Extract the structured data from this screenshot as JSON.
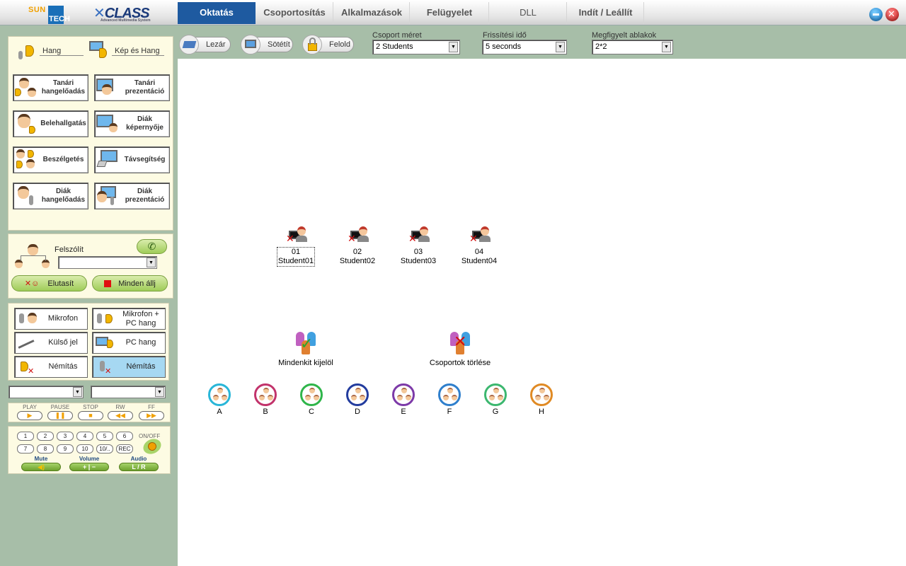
{
  "brand": {
    "sun": "SUN",
    "tech": "TECH",
    "product": "CLASS",
    "tagline": "Advanced Multimedia System"
  },
  "tabs": [
    {
      "label": "Oktatás",
      "active": true
    },
    {
      "label": "Csoportosítás"
    },
    {
      "label": "Alkalmazások"
    },
    {
      "label": "Felügyelet"
    },
    {
      "label": "DLL"
    },
    {
      "label": "Indít / Leállít"
    }
  ],
  "window_controls": {
    "minimize": "minimize-icon",
    "close": "close-icon"
  },
  "mode_panel": {
    "audio_label": "Hang",
    "video_audio_label": "Kép és Hang",
    "buttons": [
      {
        "label": "Tanári hangelőadás",
        "icon": "teacher-audio-icon"
      },
      {
        "label": "Tanári prezentáció",
        "icon": "teacher-presentation-icon"
      },
      {
        "label": "Belehallgatás",
        "icon": "monitor-audio-icon"
      },
      {
        "label": "Diák képernyője",
        "icon": "student-screen-icon"
      },
      {
        "label": "Beszélgetés",
        "icon": "conversation-icon"
      },
      {
        "label": "Távsegítség",
        "icon": "remote-help-icon"
      },
      {
        "label": "Diák hangelőadás",
        "icon": "student-audio-icon"
      },
      {
        "label": "Diák prezentáció",
        "icon": "student-presentation-icon"
      }
    ]
  },
  "call_panel": {
    "call_label": "Felszólít",
    "call_value": "",
    "reject_label": "Elutasít",
    "stop_all_label": "Minden állj"
  },
  "source_panel": {
    "buttons": [
      {
        "label": "Mikrofon",
        "selected": false
      },
      {
        "label": "Mikrofon + PC hang",
        "selected": false
      },
      {
        "label": "Külső jel",
        "selected": false
      },
      {
        "label": "PC hang",
        "selected": false
      },
      {
        "label": "Némítás",
        "selected": false
      },
      {
        "label": "Némítás",
        "selected": true
      }
    ]
  },
  "player": {
    "combo1": "",
    "combo2": "",
    "controls": [
      {
        "label": "PLAY",
        "glyph": "▶"
      },
      {
        "label": "PAUSE",
        "glyph": "❚❚"
      },
      {
        "label": "STOP",
        "glyph": "■"
      },
      {
        "label": "RW",
        "glyph": "◀◀"
      },
      {
        "label": "FF",
        "glyph": "▶▶"
      }
    ]
  },
  "keypad": {
    "row1": [
      "1",
      "2",
      "3",
      "4",
      "5",
      "6"
    ],
    "row2": [
      "7",
      "8",
      "9",
      "10",
      "10/..",
      "REC"
    ],
    "onoff": "ON/OFF",
    "mute_label": "Mute",
    "volume_label": "Volume",
    "volume_glyph": "+ | −",
    "audio_label": "Audio",
    "audio_glyph": "L / R"
  },
  "toolbar": {
    "lock": "Lezár",
    "blackout": "Sötétít",
    "unlock": "Felold",
    "group_size_label": "Csoport méret",
    "group_size_value": "2 Students",
    "refresh_label": "Frissítési idő",
    "refresh_value": "5 seconds",
    "windows_label": "Megfigyelt ablakok",
    "windows_value": "2*2"
  },
  "students": [
    {
      "num": "01",
      "name": "Student01",
      "selected": true
    },
    {
      "num": "02",
      "name": "Student02"
    },
    {
      "num": "03",
      "name": "Student03"
    },
    {
      "num": "04",
      "name": "Student04"
    }
  ],
  "actions": {
    "select_all": "Mindenkit kijelöl",
    "delete_groups": "Csoportok törlése"
  },
  "groups": [
    {
      "label": "A",
      "color": "#29b6d8"
    },
    {
      "label": "B",
      "color": "#c2336b"
    },
    {
      "label": "C",
      "color": "#2fb54a"
    },
    {
      "label": "D",
      "color": "#233c9e"
    },
    {
      "label": "E",
      "color": "#7d3aa8"
    },
    {
      "label": "F",
      "color": "#2f7fcc"
    },
    {
      "label": "G",
      "color": "#3cb76f"
    },
    {
      "label": "H",
      "color": "#e08a24"
    }
  ]
}
